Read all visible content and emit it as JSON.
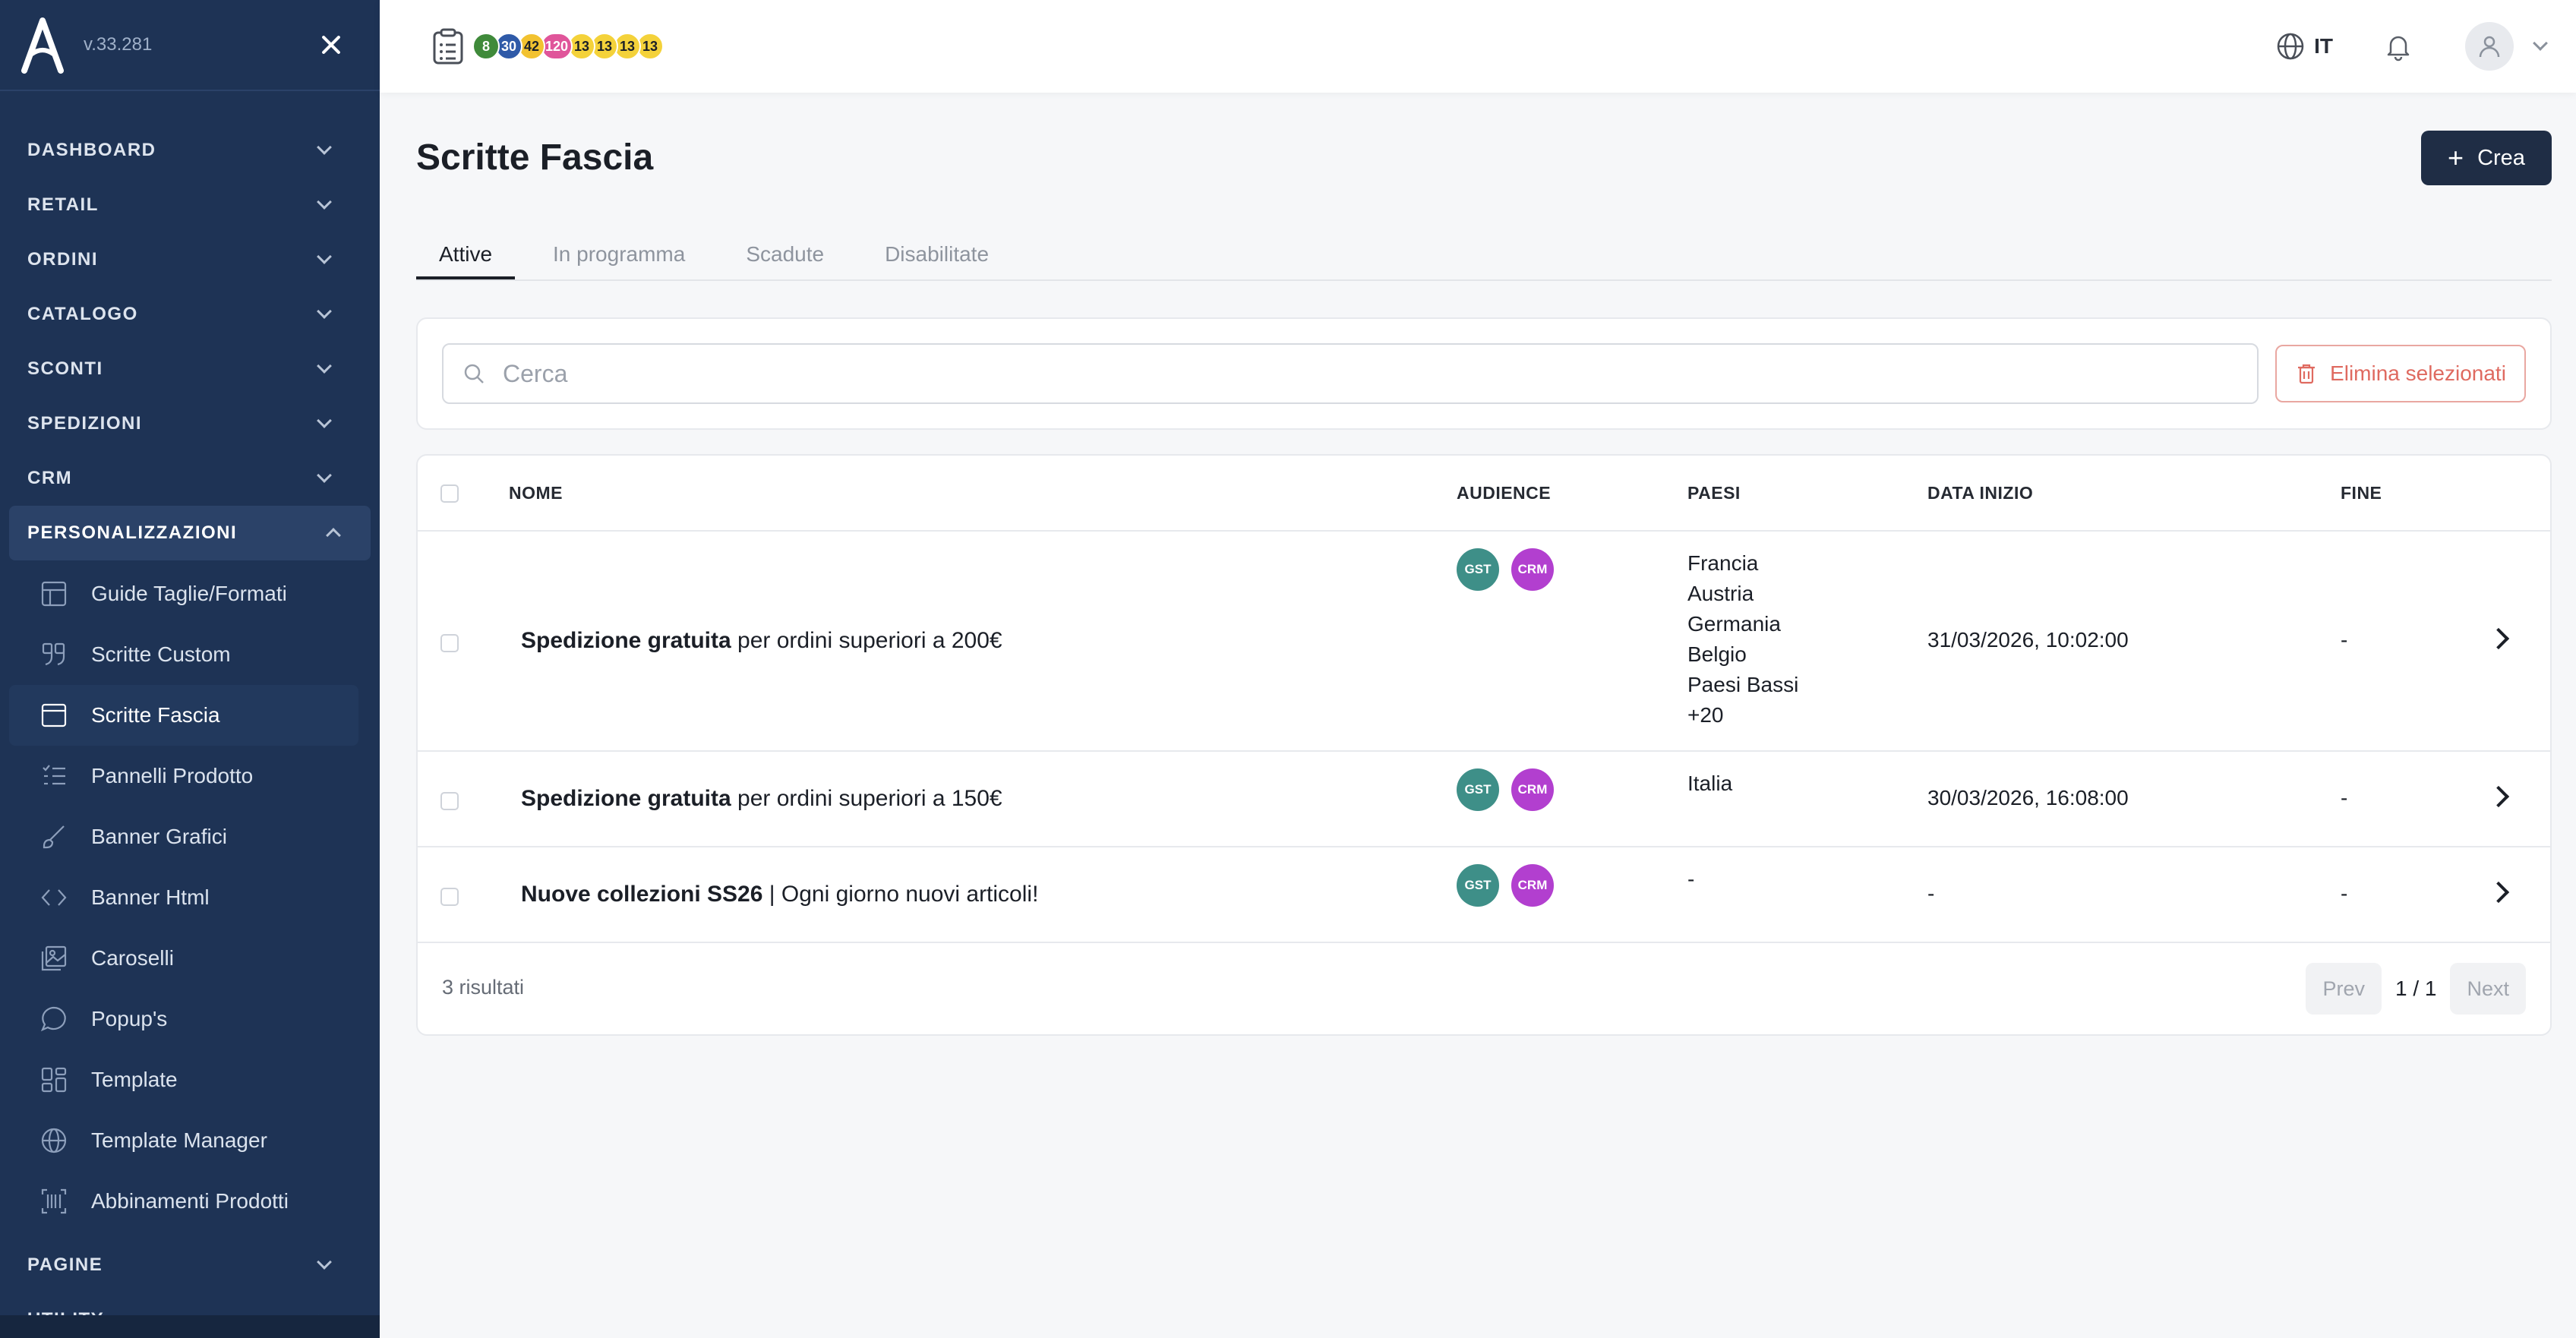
{
  "app": {
    "version": "v.33.281"
  },
  "sidebar": {
    "sections": [
      {
        "label": "DASHBOARD"
      },
      {
        "label": "RETAIL"
      },
      {
        "label": "ORDINI"
      },
      {
        "label": "CATALOGO"
      },
      {
        "label": "SCONTI"
      },
      {
        "label": "SPEDIZIONI"
      },
      {
        "label": "CRM"
      },
      {
        "label": "PERSONALIZZAZIONI"
      }
    ],
    "items": [
      {
        "label": "Guide Taglie/Formati",
        "icon": "table-icon"
      },
      {
        "label": "Scritte Custom",
        "icon": "quote-icon"
      },
      {
        "label": "Scritte Fascia",
        "icon": "window-icon",
        "active": true
      },
      {
        "label": "Pannelli Prodotto",
        "icon": "list-icon"
      },
      {
        "label": "Banner Grafici",
        "icon": "brush-icon"
      },
      {
        "label": "Banner Html",
        "icon": "code-icon"
      },
      {
        "label": "Caroselli",
        "icon": "gallery-icon"
      },
      {
        "label": "Popup's",
        "icon": "chat-icon"
      },
      {
        "label": "Template",
        "icon": "layout-icon"
      },
      {
        "label": "Template Manager",
        "icon": "globe-icon"
      },
      {
        "label": "Abbinamenti Prodotti",
        "icon": "barcode-icon"
      }
    ],
    "bottom_sections": [
      {
        "label": "PAGINE"
      },
      {
        "label": "UTILITY"
      }
    ]
  },
  "topbar": {
    "badges": [
      {
        "value": "8",
        "bg": "#3f8a3a",
        "fg": "#ffffff"
      },
      {
        "value": "30",
        "bg": "#2f5aa8",
        "fg": "#ffffff"
      },
      {
        "value": "42",
        "bg": "#f2c230",
        "fg": "#1b1f27"
      },
      {
        "value": "120",
        "bg": "#e0559a",
        "fg": "#ffffff"
      },
      {
        "value": "13",
        "bg": "#f4d23a",
        "fg": "#1b1f27"
      },
      {
        "value": "13",
        "bg": "#f4d23a",
        "fg": "#1b1f27"
      },
      {
        "value": "13",
        "bg": "#f4d23a",
        "fg": "#1b1f27"
      },
      {
        "value": "13",
        "bg": "#f4d23a",
        "fg": "#1b1f27"
      }
    ],
    "language": "IT"
  },
  "page": {
    "title": "Scritte Fascia",
    "create_label": "Crea",
    "tabs": [
      "Attive",
      "In programma",
      "Scadute",
      "Disabilitate"
    ],
    "search_placeholder": "Cerca",
    "delete_label": "Elimina selezionati"
  },
  "table": {
    "headers": {
      "name": "NOME",
      "audience": "AUDIENCE",
      "countries": "PAESI",
      "start": "DATA INIZIO",
      "end": "FINE"
    },
    "audience_colors": {
      "GST": "#3e8f88",
      "CRM": "#b23fcf"
    },
    "rows": [
      {
        "name_bold": "Spedizione gratuita",
        "name_rest": " per ordini superiori a 200€",
        "audience": [
          "GST",
          "CRM"
        ],
        "countries": [
          "Francia",
          "Austria",
          "Germania",
          "Belgio",
          "Paesi Bassi",
          "+20"
        ],
        "start": "31/03/2026, 10:02:00",
        "end": "-"
      },
      {
        "name_bold": "Spedizione gratuita",
        "name_rest": " per ordini superiori a 150€",
        "audience": [
          "GST",
          "CRM"
        ],
        "countries": [
          "Italia"
        ],
        "start": "30/03/2026, 16:08:00",
        "end": "-"
      },
      {
        "name_bold": "Nuove collezioni SS26",
        "name_rest": " | Ogni giorno nuovi articoli!",
        "audience": [
          "GST",
          "CRM"
        ],
        "countries": [
          "-"
        ],
        "start": "-",
        "end": "-"
      }
    ],
    "results": "3 risultati",
    "pager": {
      "prev": "Prev",
      "page": "1 / 1",
      "next": "Next"
    }
  },
  "colors": {
    "sidebar": "#1e3355",
    "primary": "#1f2d45",
    "danger": "#df6a60"
  }
}
